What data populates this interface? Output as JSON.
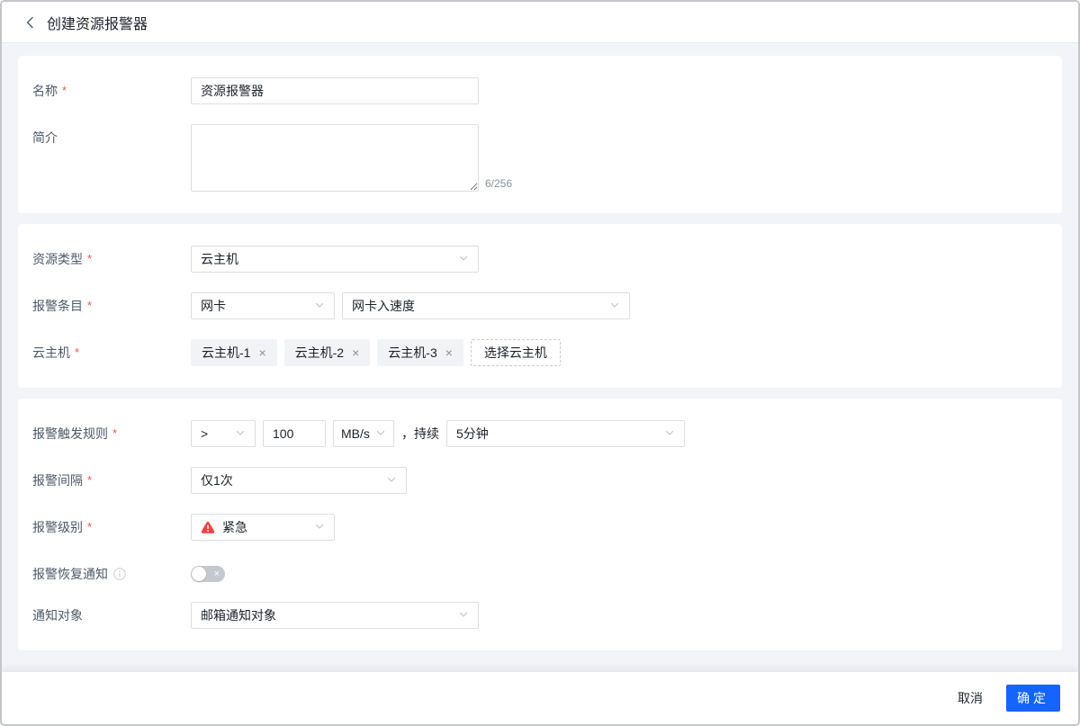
{
  "header": {
    "title": "创建资源报警器"
  },
  "required_marker": "*",
  "form": {
    "name": {
      "label": "名称",
      "value": "资源报警器"
    },
    "intro": {
      "label": "简介",
      "value": "",
      "counter": "6/256"
    },
    "resource_type": {
      "label": "资源类型",
      "value": "云主机"
    },
    "alarm_item": {
      "label": "报警条目",
      "category": "网卡",
      "metric": "网卡入速度"
    },
    "cloud_host": {
      "label": "云主机",
      "tags": [
        "云主机-1",
        "云主机-2",
        "云主机-3"
      ],
      "select_button": "选择云主机"
    },
    "trigger_rule": {
      "label": "报警触发规则",
      "operator": ">",
      "threshold": "100",
      "unit": "MB/s",
      "connector": "，持续",
      "duration": "5分钟"
    },
    "interval": {
      "label": "报警间隔",
      "value": "仅1次"
    },
    "level": {
      "label": "报警级别",
      "value": "紧急"
    },
    "recovery_notice": {
      "label": "报警恢复通知",
      "state": "off"
    },
    "notify_target": {
      "label": "通知对象",
      "value": "邮箱通知对象"
    }
  },
  "footer": {
    "cancel": "取消",
    "confirm": "确定"
  },
  "icons": {
    "tag_remove": "×",
    "toggle_off_mark": "×"
  },
  "colors": {
    "primary": "#1664ff",
    "danger": "#f53f3f",
    "page_background": "#f3f4f8",
    "tag_background": "#f2f3f5"
  }
}
